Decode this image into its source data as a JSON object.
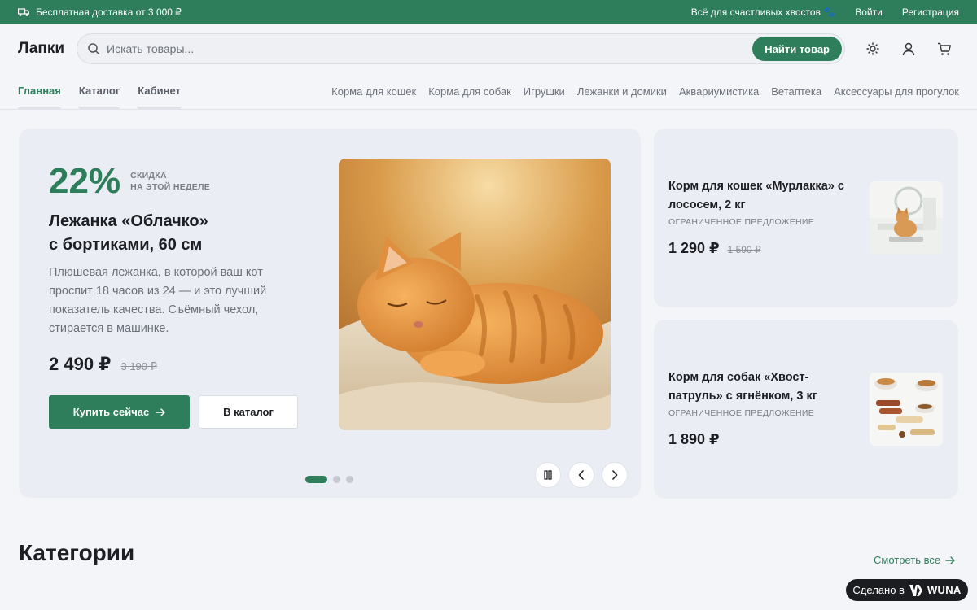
{
  "topbar": {
    "shipping": "Бесплатная доставка от 3 000 ₽",
    "promo": "Всё для счастливых хвостов 🐾",
    "login": "Войти",
    "register": "Регистрация"
  },
  "header": {
    "logo": "Лапки",
    "search_placeholder": "Искать товары...",
    "search_button": "Найти товар"
  },
  "nav": {
    "main": [
      {
        "label": "Главная",
        "active": true
      },
      {
        "label": "Каталог"
      },
      {
        "label": "Кабинет"
      }
    ],
    "categories": [
      "Корма для кошек",
      "Корма для собак",
      "Игрушки",
      "Лежанки и домики",
      "Аквариумистика",
      "Ветаптека",
      "Аксессуары для прогулок"
    ]
  },
  "hero": {
    "discount": "22%",
    "discount_label_1": "СКИДКА",
    "discount_label_2": "НА ЭТОЙ НЕДЕЛЕ",
    "title_1": "Лежанка «Облачко»",
    "title_2": "с бортиками, 60 см",
    "description": "Плюшевая лежанка, в которой ваш кот проспит 18 часов из 24 — и это лучший показатель качества. Съёмный чехол, стирается в машинке.",
    "price": "2 490 ₽",
    "old_price": "3 190 ₽",
    "buy_button": "Купить сейчас",
    "catalog_button": "В каталог",
    "slides": 3,
    "active_slide": 1
  },
  "cards": [
    {
      "title": "Корм для кошек «Мурлакка» с лососем, 2 кг",
      "tag": "ОГРАНИЧЕННОЕ ПРЕДЛОЖЕНИЕ",
      "price": "1 290 ₽",
      "old_price": "1 590 ₽"
    },
    {
      "title": "Корм для собак «Хвост-патруль» с ягнёнком, 3 кг",
      "tag": "ОГРАНИЧЕННОЕ ПРЕДЛОЖЕНИЕ",
      "price": "1 890 ₽"
    }
  ],
  "categories": {
    "title": "Категории",
    "see_all": "Смотреть все"
  },
  "badge": {
    "made_in": "Сделано в",
    "brand": "WUNA"
  },
  "colors": {
    "accent": "#2e7d5b",
    "background": "#f4f5f9",
    "card": "#eaedf3"
  }
}
